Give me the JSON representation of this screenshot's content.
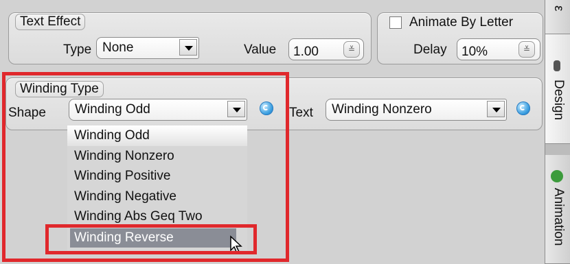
{
  "text_effect": {
    "title": "Text Effect",
    "type_label": "Type",
    "type_value": "None",
    "value_label": "Value",
    "value_value": "1.00"
  },
  "animate": {
    "checkbox_label": "Animate By Letter",
    "checked": false,
    "delay_label": "Delay",
    "delay_value": "10%"
  },
  "winding": {
    "title": "Winding Type",
    "shape_label": "Shape",
    "shape_value": "Winding Odd",
    "text_label": "Text",
    "text_value": "Winding Nonzero",
    "options": [
      "Winding Odd",
      "Winding Nonzero",
      "Winding Positive",
      "Winding Negative",
      "Winding Abs Geq Two",
      "Winding Reverse"
    ],
    "highlighted_option": "Winding Reverse"
  },
  "side_tabs": {
    "top_partial": "ε",
    "design": "Design",
    "animation": "Animation"
  },
  "colors": {
    "highlight_red": "#e0282c",
    "selected_item_bg": "#8a8d96"
  }
}
